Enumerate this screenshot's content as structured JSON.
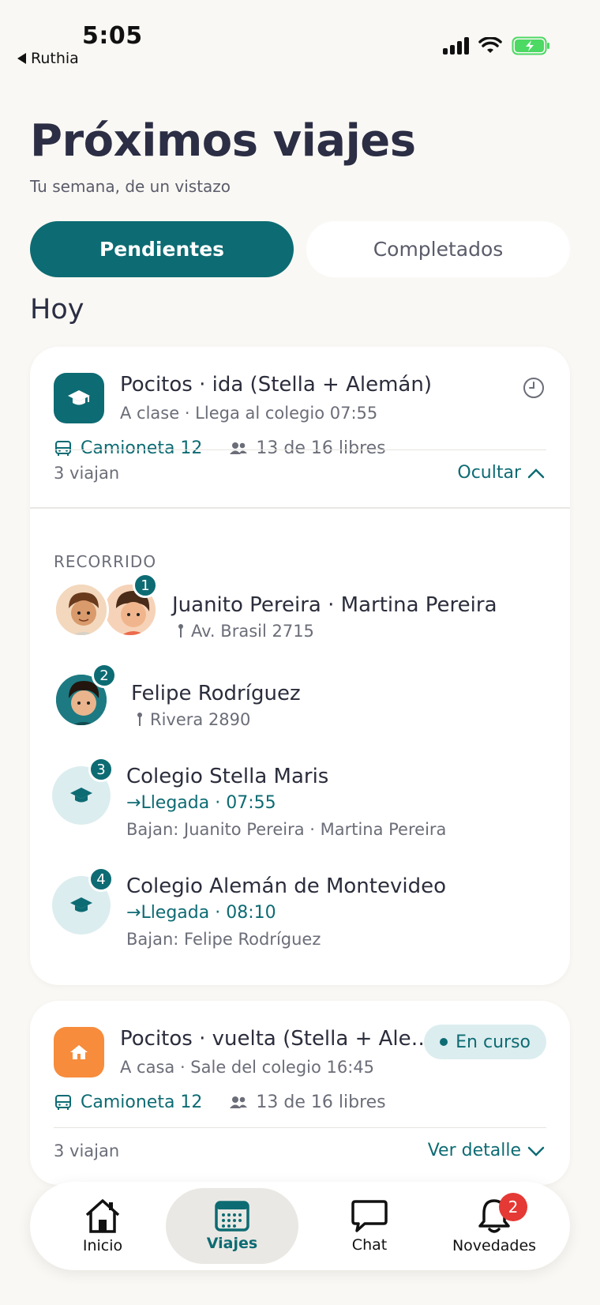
{
  "status_bar": {
    "time": "5:05",
    "back_app": "Ruthia"
  },
  "header": {
    "title": "Próximos viajes",
    "subtitle": "Tu semana, de un vistazo"
  },
  "tabs": [
    {
      "label": "Pendientes",
      "active": true
    },
    {
      "label": "Completados",
      "active": false
    }
  ],
  "section": {
    "label": "Hoy"
  },
  "trips": [
    {
      "title": "Pocitos · ida (Stella + Alemán)",
      "subtitle": "A clase · Llega al colegio 07:55",
      "vehicle": "Camioneta 12",
      "seats": "13 de 16 libres",
      "riders": "3 viajan",
      "toggle": "Ocultar",
      "icon": "graduation-cap-icon",
      "icon_color": "#0d6b73",
      "route_label": "RECORRIDO",
      "stops": [
        {
          "num": "1",
          "name": "Juanito Pereira · Martina Pereira",
          "address": "Av. Brasil 2715"
        },
        {
          "num": "2",
          "name": "Felipe Rodríguez",
          "address": "Rivera 2890"
        },
        {
          "num": "3",
          "name": "Colegio Stella Maris",
          "arrival": "Llegada · 07:55",
          "drop": "Bajan: Juanito Pereira · Martina Pereira"
        },
        {
          "num": "4",
          "name": "Colegio Alemán de Montevideo",
          "arrival": "Llegada · 08:10",
          "drop": "Bajan: Felipe Rodríguez"
        }
      ]
    },
    {
      "title": "Pocitos · vuelta (Stella + Ale…",
      "subtitle": "A casa · Sale del colegio 16:45",
      "vehicle": "Camioneta 12",
      "seats": "13 de 16 libres",
      "riders": "3 viajan",
      "toggle": "Ver detalle",
      "status": "En curso",
      "icon": "home-icon",
      "icon_color": "#f78c3c"
    }
  ],
  "nav": [
    {
      "label": "Inicio",
      "icon": "home-icon"
    },
    {
      "label": "Viajes",
      "icon": "calendar-icon",
      "active": true
    },
    {
      "label": "Chat",
      "icon": "chat-bubble-icon"
    },
    {
      "label": "Novedades",
      "icon": "bell-icon",
      "badge": "2"
    }
  ],
  "colors": {
    "primary": "#0d6b73",
    "accent_orange": "#f78c3c",
    "badge_red": "#e53935",
    "background": "#faf8f4"
  }
}
